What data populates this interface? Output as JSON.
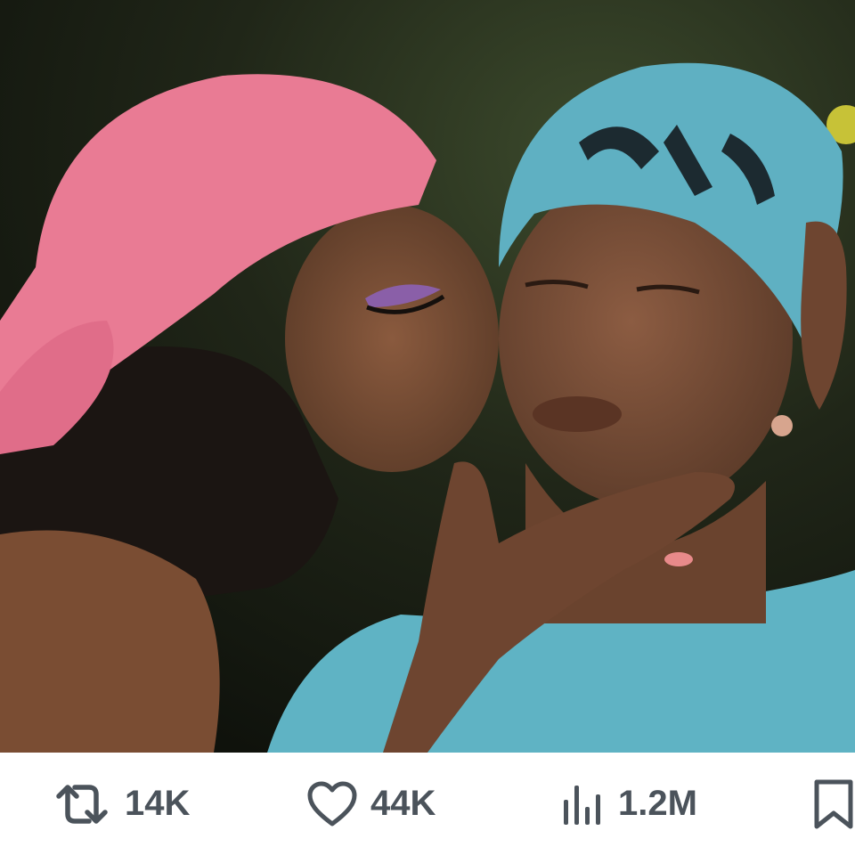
{
  "media": {
    "icon": "photo",
    "description_visible": false
  },
  "actions": {
    "retweet": {
      "icon": "retweet-icon",
      "count": "14K"
    },
    "like": {
      "icon": "heart-icon",
      "count": "44K"
    },
    "views": {
      "icon": "views-bar-chart-icon",
      "count": "1.2M"
    },
    "bookmark": {
      "icon": "bookmark-icon"
    }
  },
  "colors": {
    "icon_gray": "#4b535b",
    "background": "#ffffff"
  }
}
